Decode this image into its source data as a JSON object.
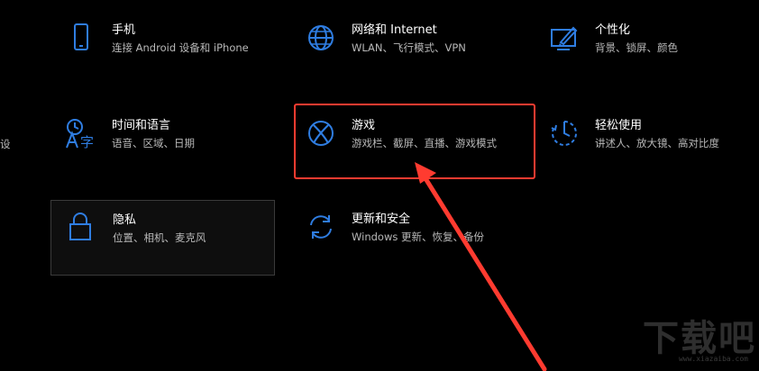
{
  "colors": {
    "background": "#000000",
    "icon_blue": "#2f7de1",
    "title_text": "#ffffff",
    "desc_text": "#b8b8b8",
    "highlight": "#ff3b30"
  },
  "left_edge_fragment": "设",
  "tiles": [
    {
      "id": "phone",
      "icon": "phone-icon",
      "title": "手机",
      "desc": "连接 Android 设备和 iPhone"
    },
    {
      "id": "network",
      "icon": "globe-icon",
      "title": "网络和 Internet",
      "desc": "WLAN、飞行模式、VPN"
    },
    {
      "id": "personalization",
      "icon": "personalize-icon",
      "title": "个性化",
      "desc": "背景、锁屏、颜色"
    },
    {
      "id": "time-language",
      "icon": "time-language-icon",
      "title": "时间和语言",
      "desc": "语音、区域、日期"
    },
    {
      "id": "gaming",
      "icon": "xbox-icon",
      "title": "游戏",
      "desc": "游戏栏、截屏、直播、游戏模式"
    },
    {
      "id": "ease-of-access",
      "icon": "ease-of-access-icon",
      "title": "轻松使用",
      "desc": "讲述人、放大镜、高对比度"
    },
    {
      "id": "privacy",
      "icon": "lock-icon",
      "title": "隐私",
      "desc": "位置、相机、麦克风"
    },
    {
      "id": "update-security",
      "icon": "sync-icon",
      "title": "更新和安全",
      "desc": "Windows 更新、恢复、备份"
    }
  ],
  "watermark": {
    "text": "下载吧",
    "url": "www.xiazaiba.com"
  }
}
